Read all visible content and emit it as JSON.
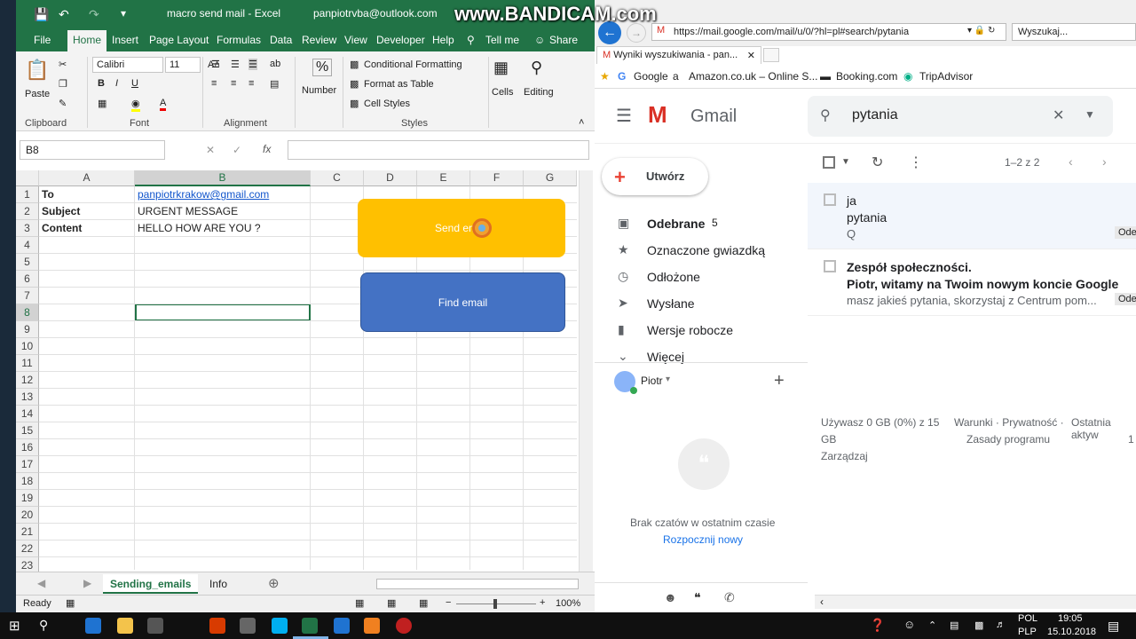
{
  "excel": {
    "title": "macro send mail  -  Excel",
    "account": "panpiotrvba@outlook.com",
    "tabs": [
      "File",
      "Home",
      "Insert",
      "Page Layout",
      "Formulas",
      "Data",
      "Review",
      "View",
      "Developer",
      "Help",
      "Tell me",
      "Share"
    ],
    "ribbon": {
      "paste": "Paste",
      "font_name": "Calibri",
      "font_size": "11",
      "number": "Number",
      "cond_format": "Conditional Formatting",
      "format_table": "Format as Table",
      "cell_styles": "Cell Styles",
      "cells": "Cells",
      "editing": "Editing",
      "groups": [
        "Clipboard",
        "Font",
        "Alignment",
        "Styles"
      ]
    },
    "name_box": "B8",
    "columns": [
      "A",
      "B",
      "C",
      "D",
      "E",
      "F",
      "G"
    ],
    "rows": [
      "1",
      "2",
      "3",
      "4",
      "5",
      "6",
      "7",
      "8",
      "9",
      "10",
      "11",
      "12",
      "13",
      "14",
      "15",
      "16",
      "17",
      "18",
      "19",
      "20",
      "21",
      "22",
      "23"
    ],
    "cells": {
      "A1": "To",
      "B1": "panpiotrkrakow@gmail.com",
      "A2": "Subject",
      "B2": "URGENT MESSAGE",
      "A3": "Content",
      "B3": "HELLO HOW ARE YOU ?"
    },
    "buttons": {
      "send": "Send email",
      "find": "Find email"
    },
    "sheets": [
      "Sending_emails",
      "Info"
    ],
    "status": "Ready",
    "zoom": "100%"
  },
  "browser": {
    "watermark": "www.BANDICAM.com",
    "url": "https://mail.google.com/mail/u/0/?hl=pl#search/pytania",
    "search_placeholder": "Wyszukaj...",
    "tab_title": "Wyniki wyszukiwania - pan...",
    "bookmarks": [
      "Google",
      "Amazon.co.uk – Online S...",
      "Booking.com",
      "TripAdvisor"
    ],
    "gmail": {
      "logo": "Gmail",
      "search": "pytania",
      "compose": "Utwórz",
      "nav": [
        {
          "label": "Odebrane",
          "count": "5"
        },
        {
          "label": "Oznaczone gwiazdką"
        },
        {
          "label": "Odłożone"
        },
        {
          "label": "Wysłane"
        },
        {
          "label": "Wersje robocze"
        },
        {
          "label": "Więcej"
        }
      ],
      "user": "Piotr",
      "pager": "1–2 z 2",
      "mails": [
        {
          "from": "ja",
          "subject": "pytania",
          "snippet": "Q",
          "tag": "Ode"
        },
        {
          "from": "Zespół społeczności.",
          "subject": "Piotr, witamy na Twoim nowym koncie Google",
          "snippet": "masz jakieś pytania, skorzystaj z Centrum pom...",
          "tag": "Ode"
        }
      ],
      "footer": {
        "usage1": "Używasz 0 GB (0%) z 15",
        "usage2": "GB",
        "manage": "Zarządzaj",
        "terms": "Warunki · Prywatność ·",
        "policy": "Zasady programu",
        "activity": "Ostatnia aktyw",
        "activity2": "1"
      },
      "chat_empty": "Brak czatów w ostatnim czasie",
      "chat_start": "Rozpocznij nowy"
    }
  },
  "taskbar": {
    "lang1": "POL",
    "lang2": "PLP",
    "time": "19:05",
    "date": "15.10.2018"
  }
}
